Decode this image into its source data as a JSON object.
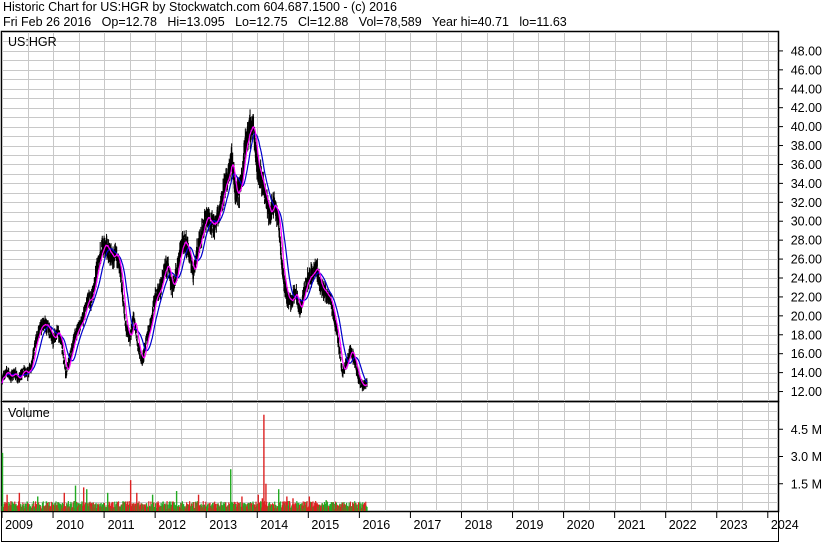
{
  "header": {
    "line1": "Historic Chart for US:HGR by Stockwatch.com 604.687.1500 - (c) 2016",
    "line2": "Fri Feb 26 2016   Op=12.78   Hi=13.095   Lo=12.75   Cl=12.88   Vol=78,589   Year hi=40.71   lo=11.63"
  },
  "chart_data": {
    "type": "candlestick",
    "price_panel": {
      "label": "US:HGR",
      "ylim": [
        11,
        50
      ],
      "ticks": [
        "48.00",
        "46.00",
        "44.00",
        "42.00",
        "40.00",
        "38.00",
        "36.00",
        "34.00",
        "32.00",
        "30.00",
        "28.00",
        "26.00",
        "24.00",
        "22.00",
        "20.00",
        "18.00",
        "16.00",
        "14.00",
        "12.00"
      ],
      "tick_values": [
        48,
        46,
        44,
        42,
        40,
        38,
        36,
        34,
        32,
        30,
        28,
        26,
        24,
        22,
        20,
        18,
        16,
        14,
        12
      ],
      "colors": {
        "bars": "#000000",
        "ma_short": "#ff00ff",
        "ma_long": "#0000cc"
      },
      "series": [
        {
          "values": [
            [
              2009.0,
              13.2
            ],
            [
              2009.08,
              14.2
            ],
            [
              2009.17,
              13.5
            ],
            [
              2009.25,
              14.0
            ],
            [
              2009.33,
              13.3
            ],
            [
              2009.42,
              14.2
            ],
            [
              2009.5,
              13.8
            ],
            [
              2009.58,
              14.9
            ],
            [
              2009.67,
              17.5
            ],
            [
              2009.75,
              18.7
            ],
            [
              2009.83,
              19.2
            ],
            [
              2009.92,
              18.6
            ],
            [
              2010.0,
              17.5
            ],
            [
              2010.08,
              18.5
            ],
            [
              2010.17,
              17.0
            ],
            [
              2010.25,
              13.8
            ],
            [
              2010.33,
              15.5
            ],
            [
              2010.42,
              17.8
            ],
            [
              2010.5,
              18.8
            ],
            [
              2010.58,
              19.5
            ],
            [
              2010.67,
              21.5
            ],
            [
              2010.75,
              21.8
            ],
            [
              2010.83,
              24.0
            ],
            [
              2010.92,
              26.5
            ],
            [
              2011.0,
              27.5
            ],
            [
              2011.08,
              27.0
            ],
            [
              2011.17,
              26.0
            ],
            [
              2011.25,
              26.5
            ],
            [
              2011.33,
              24.0
            ],
            [
              2011.42,
              19.0
            ],
            [
              2011.5,
              17.5
            ],
            [
              2011.58,
              19.8
            ],
            [
              2011.67,
              16.5
            ],
            [
              2011.75,
              15.2
            ],
            [
              2011.83,
              17.5
            ],
            [
              2011.92,
              19.5
            ],
            [
              2012.0,
              22.0
            ],
            [
              2012.08,
              22.5
            ],
            [
              2012.17,
              24.5
            ],
            [
              2012.25,
              25.5
            ],
            [
              2012.33,
              23.0
            ],
            [
              2012.42,
              24.5
            ],
            [
              2012.5,
              27.0
            ],
            [
              2012.58,
              28.0
            ],
            [
              2012.67,
              26.5
            ],
            [
              2012.75,
              24.5
            ],
            [
              2012.83,
              27.0
            ],
            [
              2012.92,
              29.0
            ],
            [
              2013.0,
              30.5
            ],
            [
              2013.08,
              30.0
            ],
            [
              2013.17,
              29.5
            ],
            [
              2013.25,
              31.0
            ],
            [
              2013.33,
              33.0
            ],
            [
              2013.42,
              34.5
            ],
            [
              2013.5,
              36.5
            ],
            [
              2013.58,
              32.5
            ],
            [
              2013.67,
              33.5
            ],
            [
              2013.75,
              37.5
            ],
            [
              2013.83,
              39.5
            ],
            [
              2013.92,
              40.2
            ],
            [
              2014.0,
              36.0
            ],
            [
              2014.08,
              34.5
            ],
            [
              2014.17,
              32.5
            ],
            [
              2014.25,
              30.5
            ],
            [
              2014.33,
              32.0
            ],
            [
              2014.42,
              30.0
            ],
            [
              2014.5,
              24.5
            ],
            [
              2014.58,
              22.0
            ],
            [
              2014.67,
              21.5
            ],
            [
              2014.75,
              22.5
            ],
            [
              2014.83,
              20.5
            ],
            [
              2014.92,
              22.5
            ],
            [
              2015.0,
              24.0
            ],
            [
              2015.08,
              24.5
            ],
            [
              2015.17,
              25.0
            ],
            [
              2015.25,
              23.0
            ],
            [
              2015.33,
              22.5
            ],
            [
              2015.42,
              22.0
            ],
            [
              2015.5,
              20.0
            ],
            [
              2015.58,
              17.5
            ],
            [
              2015.67,
              14.0
            ],
            [
              2015.75,
              15.0
            ],
            [
              2015.83,
              16.5
            ],
            [
              2015.92,
              15.0
            ],
            [
              2016.0,
              13.0
            ],
            [
              2016.08,
              12.5
            ],
            [
              2016.15,
              12.9
            ]
          ]
        }
      ]
    },
    "volume_panel": {
      "label": "Volume",
      "ylim": [
        0,
        6.0
      ],
      "ticks": [
        "4.5 M",
        "3.0 M",
        "1.5 M"
      ],
      "tick_values": [
        4.5,
        3.0,
        1.5
      ],
      "colors": {
        "up": "#22aa22",
        "down": "#dd2222"
      },
      "spikes": [
        {
          "x": 2009.01,
          "value": 3.2,
          "dir": "up"
        },
        {
          "x": 2009.1,
          "value": 0.9,
          "dir": "down"
        },
        {
          "x": 2009.34,
          "value": 1.0,
          "dir": "down"
        },
        {
          "x": 2009.7,
          "value": 0.8,
          "dir": "up"
        },
        {
          "x": 2010.22,
          "value": 1.0,
          "dir": "down"
        },
        {
          "x": 2010.44,
          "value": 1.4,
          "dir": "up"
        },
        {
          "x": 2010.6,
          "value": 1.3,
          "dir": "down"
        },
        {
          "x": 2010.66,
          "value": 1.2,
          "dir": "up"
        },
        {
          "x": 2011.07,
          "value": 1.0,
          "dir": "up"
        },
        {
          "x": 2011.52,
          "value": 1.7,
          "dir": "down"
        },
        {
          "x": 2011.64,
          "value": 1.0,
          "dir": "down"
        },
        {
          "x": 2011.95,
          "value": 0.9,
          "dir": "up"
        },
        {
          "x": 2012.42,
          "value": 1.1,
          "dir": "up"
        },
        {
          "x": 2012.85,
          "value": 0.9,
          "dir": "down"
        },
        {
          "x": 2013.48,
          "value": 2.3,
          "dir": "up"
        },
        {
          "x": 2013.7,
          "value": 0.8,
          "dir": "down"
        },
        {
          "x": 2014.02,
          "value": 0.9,
          "dir": "down"
        },
        {
          "x": 2014.1,
          "value": 0.7,
          "dir": "down"
        },
        {
          "x": 2014.13,
          "value": 5.3,
          "dir": "down"
        },
        {
          "x": 2014.17,
          "value": 1.5,
          "dir": "down"
        },
        {
          "x": 2014.42,
          "value": 1.2,
          "dir": "up"
        },
        {
          "x": 2014.58,
          "value": 0.8,
          "dir": "down"
        },
        {
          "x": 2014.7,
          "value": 0.7,
          "dir": "down"
        },
        {
          "x": 2015.02,
          "value": 0.8,
          "dir": "down"
        },
        {
          "x": 2015.35,
          "value": 0.6,
          "dir": "up"
        }
      ],
      "base_end": 2016.15
    },
    "x_axis": {
      "labels": [
        "2009",
        "2010",
        "2011",
        "2012",
        "2013",
        "2014",
        "2015",
        "2016",
        "2017",
        "2018",
        "2019",
        "2020",
        "2021",
        "2022",
        "2023",
        "2024"
      ],
      "xlim": [
        2009.0,
        2024.2
      ]
    }
  }
}
